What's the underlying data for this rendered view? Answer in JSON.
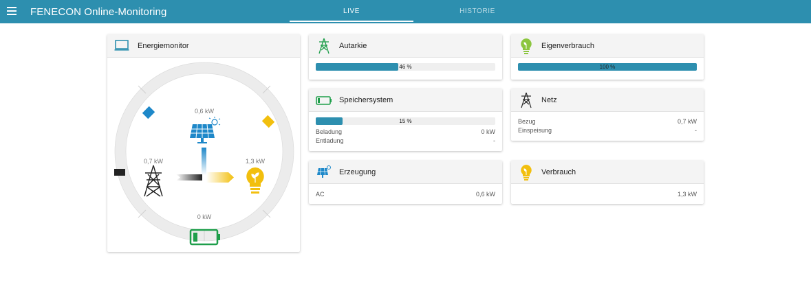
{
  "header": {
    "title": "FENECON Online-Monitoring",
    "tabs": [
      {
        "label": "LIVE"
      },
      {
        "label": "HISTORIE"
      }
    ]
  },
  "colors": {
    "accent": "#2d8faf",
    "solar_blue": "#1e88c9",
    "consumption_yellow": "#f2bf0e",
    "battery_green": "#1e9e4a"
  },
  "energiemonitor": {
    "title": "Energiemonitor",
    "icon": "monitor-icon",
    "production": {
      "value": "0,6 kW",
      "icon": "solar-panel-icon"
    },
    "grid": {
      "value": "0,7 kW",
      "icon": "pylon-icon"
    },
    "consumption": {
      "value": "1,3 kW",
      "icon": "bulb-icon"
    },
    "storage": {
      "value": "0 kW",
      "icon": "battery-icon"
    }
  },
  "autarkie": {
    "title": "Autarkie",
    "icon": "pylon-icon",
    "percent": 46,
    "label": "46 %"
  },
  "speichersystem": {
    "title": "Speichersystem",
    "icon": "battery-icon",
    "percent": 15,
    "label": "15 %",
    "rows": [
      {
        "label": "Beladung",
        "value": "0 kW"
      },
      {
        "label": "Entladung",
        "value": "-"
      }
    ]
  },
  "erzeugung": {
    "title": "Erzeugung",
    "icon": "solar-panel-icon",
    "rows": [
      {
        "label": "AC",
        "value": "0,6 kW"
      }
    ]
  },
  "eigenverbrauch": {
    "title": "Eigenverbrauch",
    "icon": "bulb-icon",
    "percent": 100,
    "label": "100 %"
  },
  "netz": {
    "title": "Netz",
    "icon": "pylon-icon",
    "rows": [
      {
        "label": "Bezug",
        "value": "0,7 kW"
      },
      {
        "label": "Einspeisung",
        "value": "-"
      }
    ]
  },
  "verbrauch": {
    "title": "Verbrauch",
    "icon": "bulb-icon",
    "value": "1,3 kW"
  }
}
